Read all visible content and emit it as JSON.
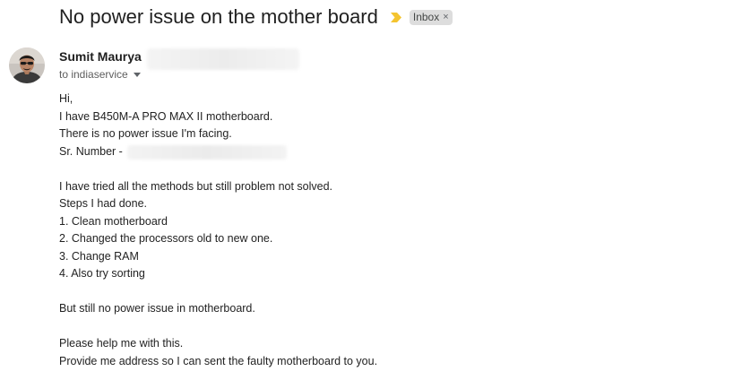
{
  "email": {
    "subject": "No power issue on the mother board",
    "label": "Inbox",
    "label_close": "×",
    "sender_name": "Sumit Maurya",
    "recipient": "to indiaservice",
    "body_lines": [
      "Hi,",
      "I have B450M-A PRO MAX II motherboard.",
      "There is no power issue I'm facing.",
      "Sr. Number -",
      "",
      "I have tried all the methods but still problem not solved.",
      "Steps I had done.",
      "1. Clean motherboard",
      "2. Changed the processors old to new one.",
      "3. Change RAM",
      "4. Also try sorting",
      "",
      "But still no power issue in motherboard.",
      "",
      "Please help me with this.",
      "Provide me address so I can sent the faulty motherboard to you."
    ]
  },
  "icons": {
    "importance": "importance-marker-icon",
    "avatar": "sender-avatar",
    "caret": "chevron-down-icon"
  },
  "colors": {
    "importance_marker": "#f4c430",
    "label_chip_bg": "#dddddd",
    "text_primary": "#1f1f1f",
    "text_secondary": "#5e5e5e"
  }
}
